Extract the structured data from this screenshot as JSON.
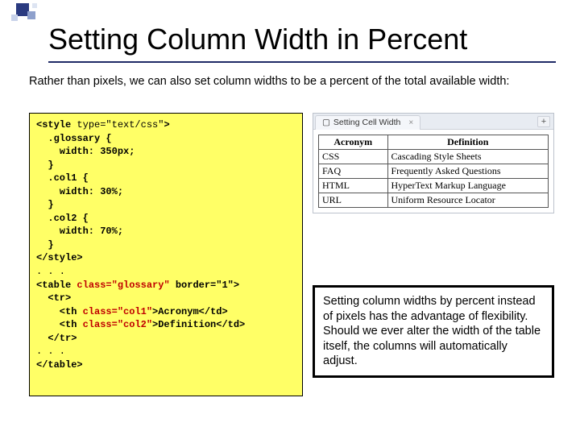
{
  "title": "Setting Column Width in Percent",
  "intro": "Rather than pixels, we can also set column widths to be a percent of the total available width:",
  "code": {
    "l01a": "<style ",
    "l01b": "type=\"text/css\"",
    "l01c": ">",
    "l02": "  .glossary {",
    "l03": "    width: 350px;",
    "l04": "  }",
    "l05": "  .col1 {",
    "l06": "    width: 30%;",
    "l07": "  }",
    "l08": "  .col2 {",
    "l09": "    width: 70%;",
    "l10": "  }",
    "l11": "</style>",
    "l12": ". . .",
    "l13a": "<table ",
    "l13b": "class=\"glossary\"",
    "l13c": " border=\"1\">",
    "l14": "  <tr>",
    "l15a": "    <th ",
    "l15b": "class=\"col1\"",
    "l15c": ">Acronym</td>",
    "l16a": "    <th ",
    "l16b": "class=\"col2\"",
    "l16c": ">Definition</td>",
    "l17": "  </tr>",
    "l18": ". . .",
    "l19": "</table>"
  },
  "browser": {
    "tab_title": "Setting Cell Width",
    "headers": {
      "c1": "Acronym",
      "c2": "Definition"
    },
    "rows": [
      {
        "c1": "CSS",
        "c2": "Cascading Style Sheets"
      },
      {
        "c1": "FAQ",
        "c2": "Frequently Asked Questions"
      },
      {
        "c1": "HTML",
        "c2": "HyperText Markup Language"
      },
      {
        "c1": "URL",
        "c2": "Uniform Resource Locator"
      }
    ]
  },
  "note": "Setting column widths by percent instead of pixels has the advantage of flexibility.  Should we ever alter the width of the table itself, the columns will automatically adjust."
}
